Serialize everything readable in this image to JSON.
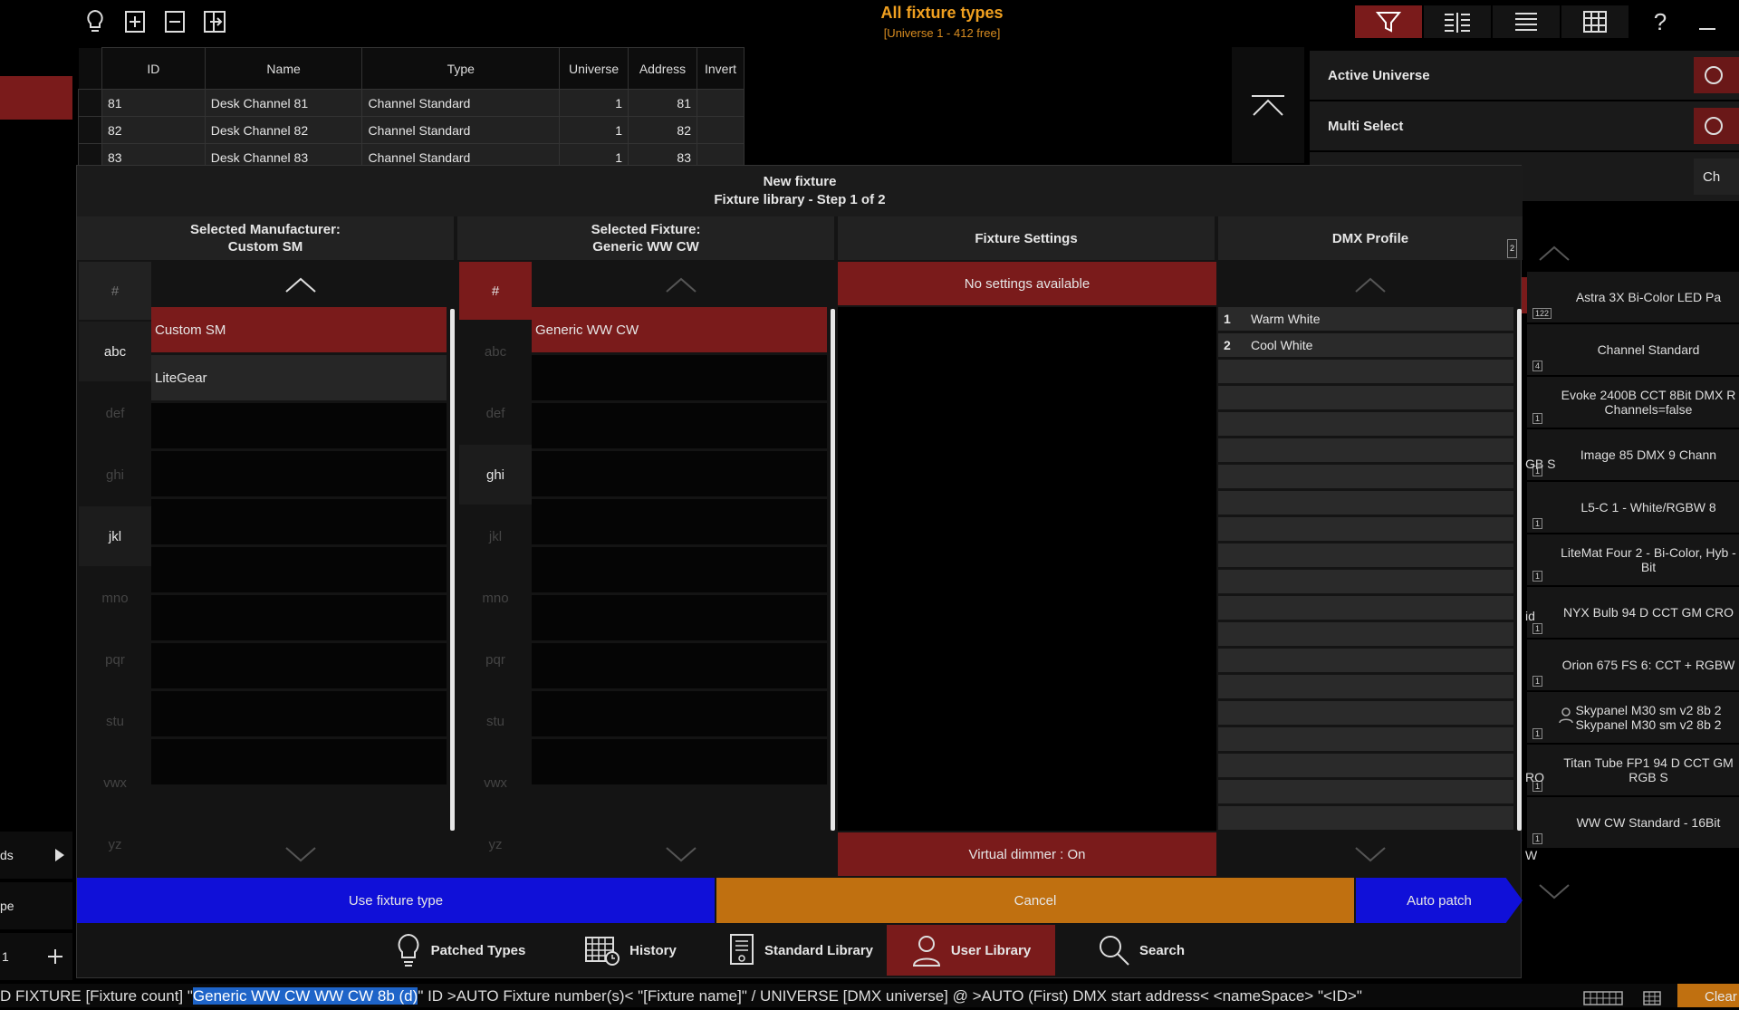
{
  "title": {
    "main": "All fixture types",
    "sub": "[Universe 1 - 412 free]"
  },
  "top_icons": [
    "lightbulb-icon",
    "add-panel-icon",
    "remove-panel-icon",
    "exit-icon"
  ],
  "grid": {
    "headers": [
      "ID",
      "Name",
      "Type",
      "Universe",
      "Address",
      "Invert"
    ],
    "rows": [
      {
        "id": "81",
        "name": "Desk Channel 81",
        "type": "Channel Standard",
        "universe": "1",
        "address": "81",
        "invert": ""
      },
      {
        "id": "82",
        "name": "Desk Channel 82",
        "type": "Channel Standard",
        "universe": "1",
        "address": "82",
        "invert": ""
      },
      {
        "id": "83",
        "name": "Desk Channel 83",
        "type": "Channel Standard",
        "universe": "1",
        "address": "83",
        "invert": ""
      }
    ]
  },
  "right_panel": {
    "active_universe": "Active Universe",
    "multi_select": "Multi Select",
    "third_btn": "Ch"
  },
  "right_list": [
    {
      "name": "Astra 3X Bi-Color LED Pa",
      "count": "122",
      "side": ""
    },
    {
      "name": "Channel Standard",
      "count": "4",
      "side": ""
    },
    {
      "name": "Evoke 2400B CCT 8Bit DMX R Channels=false",
      "count": "1",
      "side": ""
    },
    {
      "name": "Image 85 DMX 9 Chann",
      "count": "1",
      "side": "GB S"
    },
    {
      "name": "L5-C 1 - White/RGBW 8",
      "count": "1",
      "side": ""
    },
    {
      "name": "LiteMat Four 2 - Bi-Color, Hyb -Bit",
      "count": "1",
      "side": ""
    },
    {
      "name": "NYX Bulb 94 D CCT GM CRO",
      "count": "1",
      "side": "id"
    },
    {
      "name": "Orion 675 FS 6: CCT + RGBW",
      "count": "1",
      "side": ""
    },
    {
      "name": "Skypanel M30 sm v2 8b 2 Skypanel M30 sm v2 8b 2",
      "count": "1",
      "side": ""
    },
    {
      "name": "Titan Tube FP1 94 D CCT GM RGB S",
      "count": "1",
      "side": "RO"
    },
    {
      "name": "WW CW Standard - 16Bit",
      "count": "1",
      "side": "W"
    }
  ],
  "dialog": {
    "title1": "New fixture",
    "title2": "Fixture library - Step 1 of 2",
    "col1_head1": "Selected Manufacturer:",
    "col1_head2": "Custom SM",
    "col2_head1": "Selected Fixture:",
    "col2_head2": "Generic WW CW",
    "col3_head": "Fixture Settings",
    "col4_head": "DMX Profile",
    "col4_badge": "2",
    "letters": [
      "#",
      "abc",
      "def",
      "ghi",
      "jkl",
      "mno",
      "pqr",
      "stu",
      "vwx",
      "yz"
    ],
    "manufacturers": [
      "Custom SM",
      "LiteGear"
    ],
    "fixtures": [
      "Generic WW CW"
    ],
    "no_settings": "No settings available",
    "virtual_dimmer": "Virtual dimmer : On",
    "dmx_profiles": [
      {
        "n": "1",
        "name": "Warm White"
      },
      {
        "n": "2",
        "name": "Cool White"
      }
    ],
    "use_button": "Use fixture type",
    "cancel_button": "Cancel",
    "autopatch_button": "Auto patch",
    "tabs": [
      "Patched Types",
      "History",
      "Standard Library",
      "User Library",
      "Search"
    ]
  },
  "left_bottom": {
    "item1": "ds",
    "item2": "pe",
    "item3": "1"
  },
  "command_line": {
    "prefix": "D FIXTURE [Fixture count] \"",
    "highlight": "Generic WW CW WW CW 8b (d)",
    "suffix": "\" ID >AUTO Fixture number(s)< \"[Fixture name]\" / UNIVERSE [DMX universe] @ >AUTO (First) DMX start address< <nameSpace> \"<ID>\"",
    "right_btn": "Clear"
  },
  "colors": {
    "accent_red": "#7a1b1b",
    "accent_orange": "#f0a020",
    "blue": "#1010d8",
    "orange": "#c07010"
  }
}
